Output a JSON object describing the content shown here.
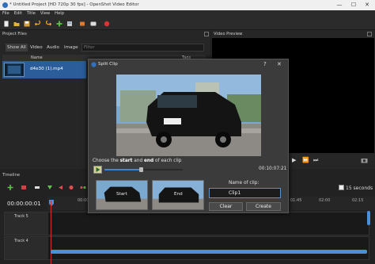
{
  "window": {
    "title": "* Untitled Project [HD 720p 30 fps] - OpenShot Video Editor",
    "minimize_glyph": "—",
    "maximize_glyph": "☐",
    "close_glyph": "✕"
  },
  "menu": [
    "File",
    "Edit",
    "Title",
    "View",
    "Help"
  ],
  "toolbar_icons": [
    "new-project-icon",
    "open-project-icon",
    "save-project-icon",
    "undo-icon",
    "redo-icon",
    "add-track-icon",
    "import-files-icon",
    "export-film-icon",
    "record-icon"
  ],
  "project_files": {
    "title": "Project Files",
    "filter_tabs": [
      "Show All",
      "Video",
      "Audio",
      "Image"
    ],
    "filter_placeholder": "Filter",
    "columns": [
      "Name",
      "Tags"
    ],
    "files": [
      {
        "name": "d4e30 (1).mp4"
      }
    ]
  },
  "video_preview": {
    "title": "Video Preview"
  },
  "timeline": {
    "title": "Timeline",
    "timecode": "00:00:00:01",
    "zoom_label": "15 seconds",
    "ruler_ticks": [
      "00:00",
      "01:45",
      "02:00",
      "02:15"
    ],
    "tracks": [
      {
        "name": "Track 5"
      },
      {
        "name": "Track 4"
      }
    ]
  },
  "dialog": {
    "title": "Split Clip",
    "help_glyph": "?",
    "close_glyph": "✕",
    "prompt_pre": "Choose the ",
    "prompt_start": "start",
    "prompt_mid": " and ",
    "prompt_end": "end",
    "prompt_post": " of each clip",
    "current_time": "00:10:07:21",
    "progress": 0.42,
    "start_label": "Start",
    "end_label": "End",
    "name_label": "Name of clip:",
    "name_value": "Clip1",
    "clear_label": "Clear",
    "create_label": "Create"
  },
  "colors": {
    "selection_blue": "#2a5d9a",
    "accent_blue": "#3f86ce",
    "playhead_red": "#d23030"
  }
}
